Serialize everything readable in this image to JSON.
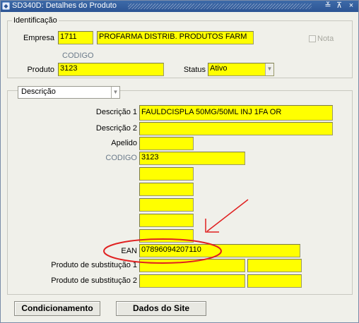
{
  "window": {
    "title": "SD340D: Detalhes do Produto",
    "app_icon": "oracle-forms-icon",
    "controls": {
      "minimize": "≚",
      "maximize": "⊼",
      "close": "×"
    }
  },
  "identificacao": {
    "group_label": "Identificação",
    "empresa_label": "Empresa",
    "empresa_code": "1711",
    "empresa_name": "PROFARMA DISTRIB. PRODUTOS FARM",
    "nota_label": "Nota",
    "codigo_header": "CODIGO",
    "produto_label": "Produto",
    "produto_value": "3123",
    "status_label": "Status",
    "status_value": "Ativo"
  },
  "detalhes": {
    "section_select": "Descrição",
    "descricao1_label": "Descrição 1",
    "descricao1_value": "FAULDCISPLA 50MG/50ML INJ 1FA OR",
    "descricao2_label": "Descrição 2",
    "descricao2_value": "",
    "apelido_label": "Apelido",
    "apelido_value": "",
    "codigo_label": "CODIGO",
    "codigo_value": "3123",
    "ean_label": "EAN",
    "ean_value": "07896094207110",
    "subst1_label": "Produto de substitução 1",
    "subst2_label": "Produto de substitução 2"
  },
  "buttons": {
    "condicionamento": "Condicionamento",
    "dados_site": "Dados do Site"
  },
  "colors": {
    "field_yellow": "#ffff00",
    "annotation_red": "#e02020",
    "title_blue": "#2c5494"
  }
}
